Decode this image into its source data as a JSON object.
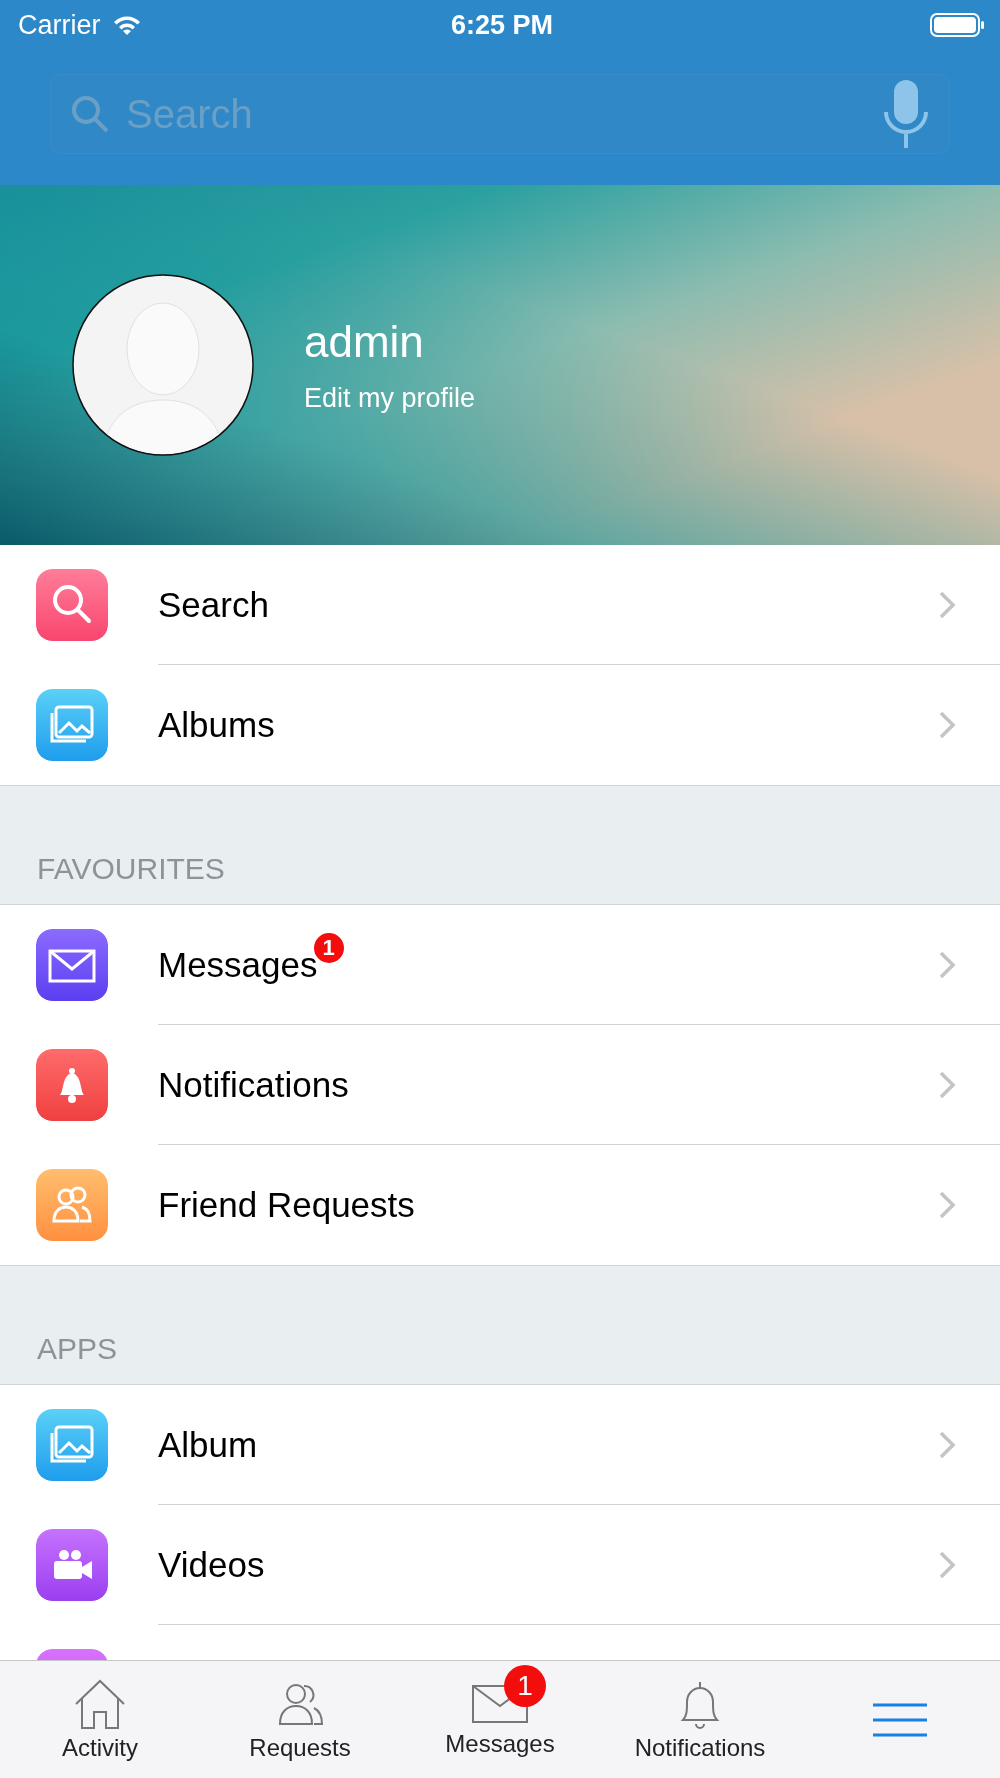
{
  "status_bar": {
    "carrier": "Carrier",
    "time": "6:25 PM"
  },
  "search": {
    "placeholder": "Search"
  },
  "profile": {
    "name": "admin",
    "subtitle": "Edit my profile"
  },
  "sections": [
    {
      "items": [
        {
          "kind": "search",
          "label": "Search"
        },
        {
          "kind": "albums",
          "label": "Albums"
        }
      ]
    },
    {
      "title": "FAVOURITES",
      "items": [
        {
          "kind": "messages",
          "label": "Messages",
          "badge": "1"
        },
        {
          "kind": "notifications",
          "label": "Notifications"
        },
        {
          "kind": "friends",
          "label": "Friend Requests"
        }
      ]
    },
    {
      "title": "APPS",
      "items": [
        {
          "kind": "albums",
          "label": "Album"
        },
        {
          "kind": "videos",
          "label": "Videos"
        },
        {
          "kind": "partial"
        }
      ]
    }
  ],
  "tab_bar": [
    {
      "kind": "activity",
      "label": "Activity",
      "selected": false
    },
    {
      "kind": "requests",
      "label": "Requests",
      "selected": false
    },
    {
      "kind": "messages",
      "label": "Messages",
      "badge": "1",
      "selected": false
    },
    {
      "kind": "notifications",
      "label": "Notifications",
      "selected": false
    },
    {
      "kind": "menu",
      "selected": true
    }
  ]
}
